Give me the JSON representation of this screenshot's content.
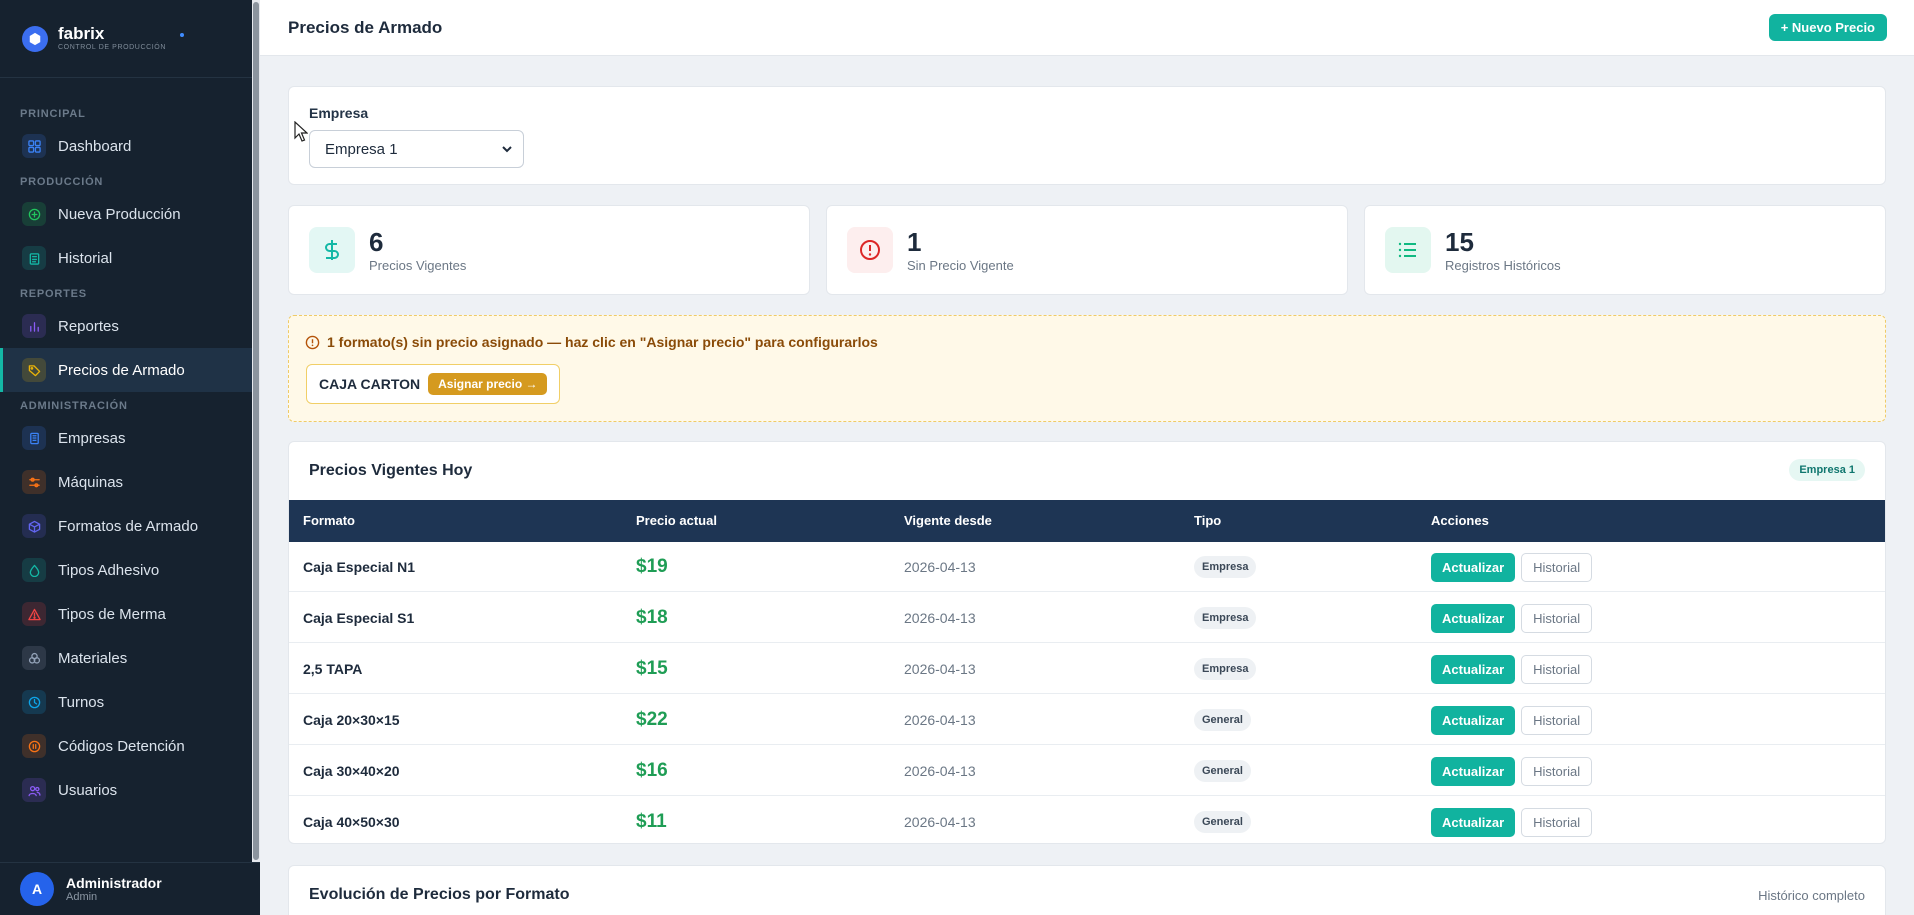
{
  "brand": {
    "name": "fabrix",
    "subtitle": "CONTROL DE PRODUCCIÓN"
  },
  "sidebar": {
    "sections": [
      {
        "title": "PRINCIPAL",
        "items": [
          {
            "label": "Dashboard",
            "icon": "grid-icon",
            "color": "#3b82f6"
          }
        ]
      },
      {
        "title": "PRODUCCIÓN",
        "items": [
          {
            "label": "Nueva Producción",
            "icon": "plus-circle-icon",
            "color": "#22c55e"
          },
          {
            "label": "Historial",
            "icon": "clipboard-icon",
            "color": "#14b8a6"
          }
        ]
      },
      {
        "title": "REPORTES",
        "items": [
          {
            "label": "Reportes",
            "icon": "bar-chart-icon",
            "color": "#8b5cf6"
          },
          {
            "label": "Precios de Armado",
            "icon": "tag-icon",
            "color": "#eab308",
            "active": true
          }
        ]
      },
      {
        "title": "ADMINISTRACIÓN",
        "items": [
          {
            "label": "Empresas",
            "icon": "building-icon",
            "color": "#3b82f6"
          },
          {
            "label": "Máquinas",
            "icon": "settings-sliders-icon",
            "color": "#f97316"
          },
          {
            "label": "Formatos de Armado",
            "icon": "box-icon",
            "color": "#6366f1"
          },
          {
            "label": "Tipos Adhesivo",
            "icon": "droplet-icon",
            "color": "#14b8a6"
          },
          {
            "label": "Tipos de Merma",
            "icon": "warning-triangle-icon",
            "color": "#ef4444"
          },
          {
            "label": "Materiales",
            "icon": "layers-icon",
            "color": "#94a3b8"
          },
          {
            "label": "Turnos",
            "icon": "clock-icon",
            "color": "#0ea5e9"
          },
          {
            "label": "Códigos Detención",
            "icon": "pause-circle-icon",
            "color": "#f97316"
          },
          {
            "label": "Usuarios",
            "icon": "users-icon",
            "color": "#8b5cf6"
          }
        ]
      }
    ]
  },
  "user": {
    "initial": "A",
    "name": "Administrador",
    "role": "Admin"
  },
  "header": {
    "title": "Precios de Armado",
    "new_button": "+ Nuevo Precio"
  },
  "filter": {
    "label": "Empresa",
    "selected": "Empresa 1"
  },
  "stats": [
    {
      "value": "6",
      "label": "Precios Vigentes",
      "icon": "dollar-icon",
      "color": "#14b8a6"
    },
    {
      "value": "1",
      "label": "Sin Precio Vigente",
      "icon": "alert-circle-icon",
      "color": "#dc2626"
    },
    {
      "value": "15",
      "label": "Registros Históricos",
      "icon": "list-icon",
      "color": "#10b981"
    }
  ],
  "alert": {
    "message": "1 formato(s) sin precio asignado — haz clic en \"Asignar precio\" para configurarlos",
    "pending": [
      {
        "name": "CAJA CARTON",
        "button": "Asignar precio →"
      }
    ]
  },
  "prices_table": {
    "title": "Precios Vigentes Hoy",
    "badge": "Empresa 1",
    "columns": [
      "Formato",
      "Precio actual",
      "Vigente desde",
      "Tipo",
      "Acciones"
    ],
    "rows": [
      {
        "formato": "Caja Especial N1",
        "precio": "$19",
        "desde": "2026-04-13",
        "tipo": "Empresa"
      },
      {
        "formato": "Caja Especial S1",
        "precio": "$18",
        "desde": "2026-04-13",
        "tipo": "Empresa"
      },
      {
        "formato": "2,5 TAPA",
        "precio": "$15",
        "desde": "2026-04-13",
        "tipo": "Empresa"
      },
      {
        "formato": "Caja 20×30×15",
        "precio": "$22",
        "desde": "2026-04-13",
        "tipo": "General"
      },
      {
        "formato": "Caja 30×40×20",
        "precio": "$16",
        "desde": "2026-04-13",
        "tipo": "General"
      },
      {
        "formato": "Caja 40×50×30",
        "precio": "$11",
        "desde": "2026-04-13",
        "tipo": "General"
      }
    ],
    "update_label": "Actualizar",
    "history_label": "Historial"
  },
  "evolution": {
    "title": "Evolución de Precios por Formato",
    "note": "Histórico completo"
  }
}
